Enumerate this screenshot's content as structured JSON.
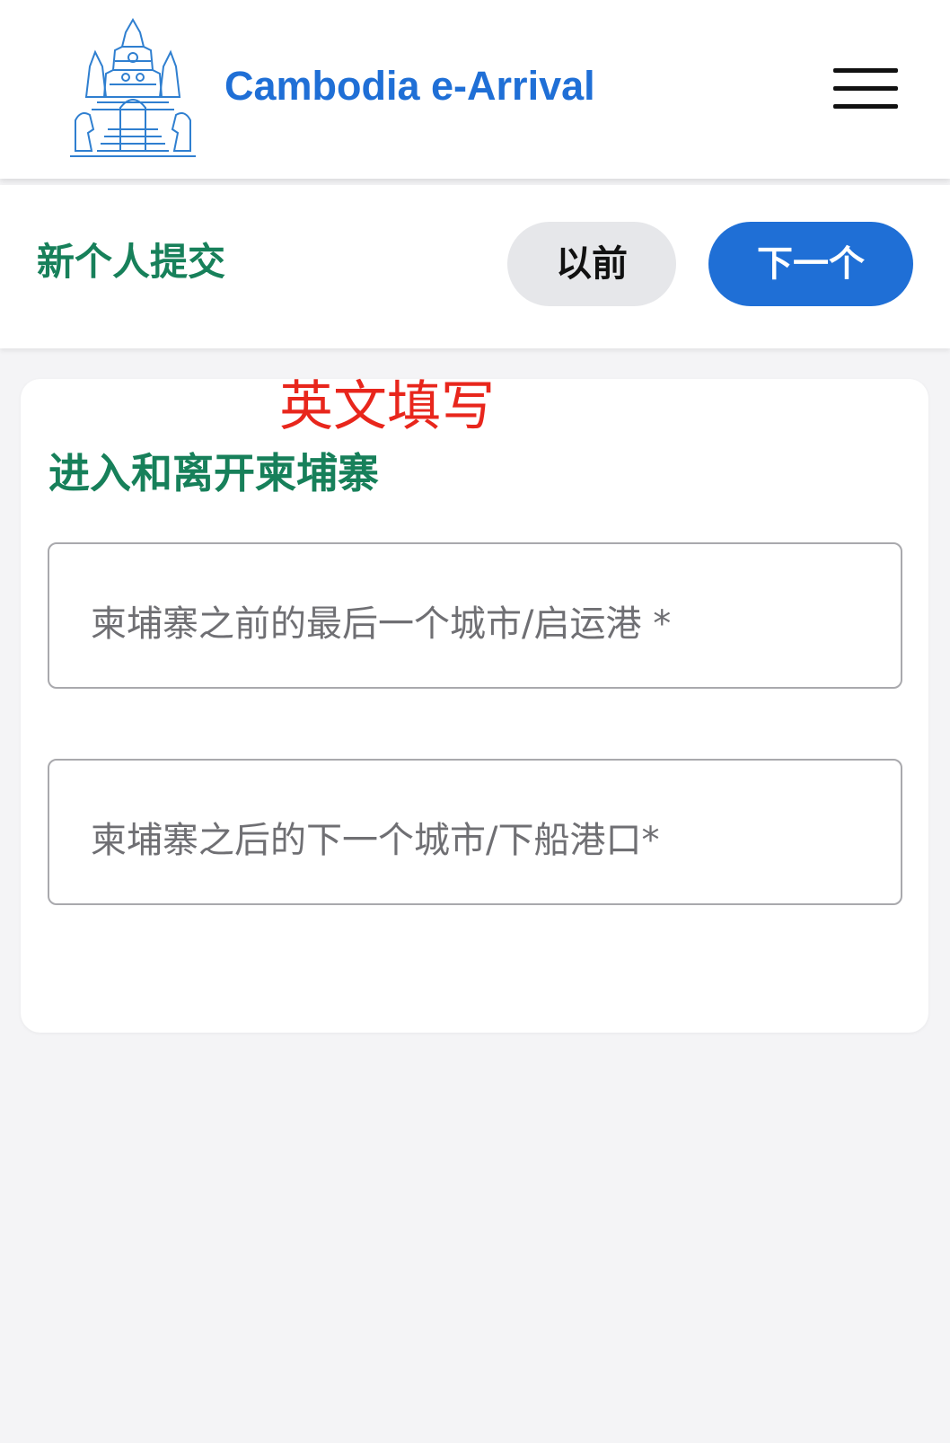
{
  "header": {
    "app_title": "Cambodia e-Arrival",
    "logo_icon": "angkor-temple-logo",
    "menu_icon": "hamburger-menu-icon",
    "brand_color": "#1f6fd6"
  },
  "subbar": {
    "title": "新个人提交",
    "prev_label": "以前",
    "next_label": "下一个"
  },
  "annotation": "英文填写",
  "form": {
    "section_title": "进入和离开柬埔寨",
    "fields": [
      {
        "placeholder": "柬埔寨之前的最后一个城市/启运港 *",
        "value": ""
      },
      {
        "placeholder": "柬埔寨之后的下一个城市/下船港口*",
        "value": ""
      }
    ]
  },
  "colors": {
    "title_green": "#17805a",
    "annotation_red": "#e8261c",
    "page_bg": "#f4f4f6"
  }
}
